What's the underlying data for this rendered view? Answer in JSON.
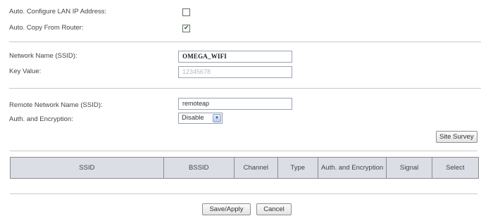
{
  "lan": {
    "auto_configure_label": "Auto. Configure LAN IP Address:",
    "auto_configure_checked": false,
    "auto_copy_label": "Auto. Copy From Router:",
    "auto_copy_checked": true
  },
  "network": {
    "ssid_label": "Network Name (SSID):",
    "ssid_value": "OMEGA_WIFI",
    "key_label": "Key Value:",
    "key_placeholder": "12345678"
  },
  "remote": {
    "ssid_label": "Remote Network Name (SSID):",
    "ssid_value": "remoteap",
    "auth_label": "Auth. and Encryption:",
    "auth_selected": "Disable"
  },
  "buttons": {
    "site_survey": "Site Survey",
    "save_apply": "Save/Apply",
    "cancel": "Cancel"
  },
  "survey_table": {
    "columns": [
      "SSID",
      "BSSID",
      "Channel",
      "Type",
      "Auth. and Encryption",
      "Signal",
      "Select"
    ]
  },
  "icons": {
    "checkmark": "checkmark-icon",
    "dropdown": "dropdown-arrow-icon"
  }
}
